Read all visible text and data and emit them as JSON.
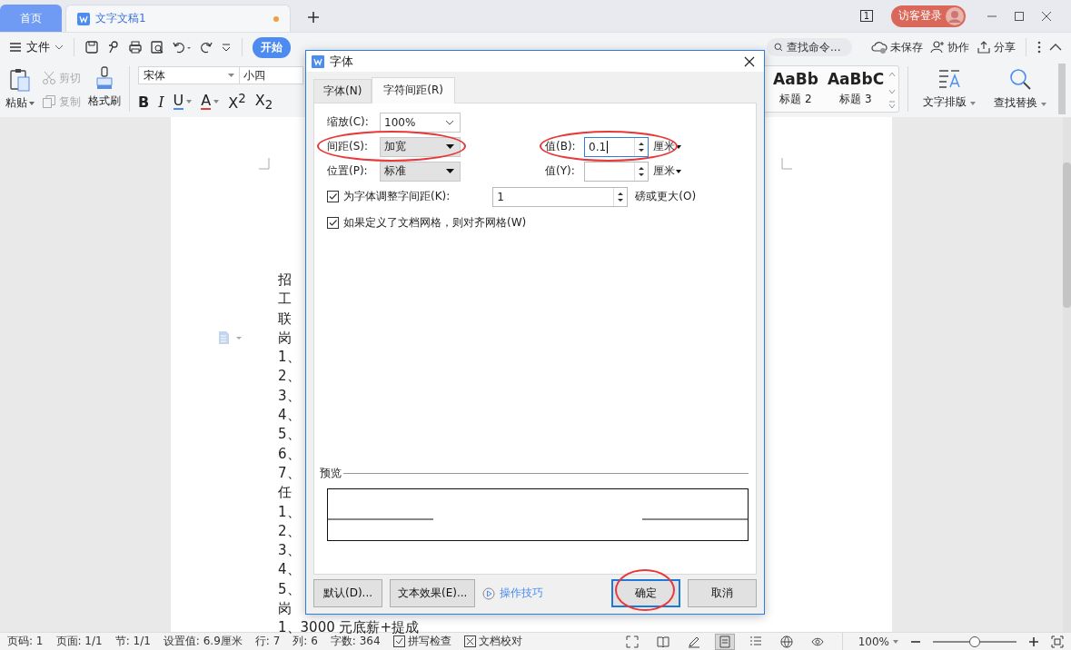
{
  "title_bar": {
    "tabs": [
      {
        "label": "首页",
        "kind": "home",
        "selected": false
      },
      {
        "label": "文字文稿1",
        "kind": "document",
        "selected": true,
        "unsaved": true
      }
    ],
    "page_count": "1",
    "login": "访客登录"
  },
  "menu_bar": {
    "file": "文件",
    "tabs": [
      {
        "label": "开始",
        "selected": true
      }
    ],
    "search": {
      "placeholder": "查找命令..."
    },
    "actions": [
      {
        "label": "未保存",
        "kind": "cloud"
      },
      {
        "label": "协作",
        "kind": "person"
      },
      {
        "label": "分享",
        "kind": "share"
      }
    ]
  },
  "ribbon": {
    "clipboard": [
      {
        "label": "粘贴",
        "kind": "paste",
        "disabled": false
      },
      {
        "label": "剪切",
        "kind": "cut",
        "disabled": true
      },
      {
        "label": "复制",
        "kind": "copy",
        "disabled": true
      },
      {
        "label": "格式刷",
        "kind": "brush",
        "disabled": false
      }
    ],
    "font": {
      "name": "宋体",
      "size": "小四"
    },
    "format_buttons": [
      {
        "label": "B",
        "kind": "bold",
        "dropdown": false
      },
      {
        "label": "I",
        "kind": "italic",
        "dropdown": false
      },
      {
        "label": "U",
        "kind": "underline",
        "dropdown": true
      },
      {
        "label": "A",
        "kind": "strike",
        "dropdown": true
      },
      {
        "label": "X$^{2}$",
        "kind": "plain",
        "dropdown": false
      },
      {
        "label": "X$_{2}$",
        "kind": "plain",
        "dropdown": false
      }
    ],
    "styles": [
      {
        "preview": "AaBb",
        "label": "标题 2"
      },
      {
        "preview": "AaBbC",
        "label": "标题 3"
      }
    ],
    "tools": [
      {
        "label": "文字排版",
        "kind": "layout"
      },
      {
        "label": "查找替换",
        "kind": "search"
      }
    ]
  },
  "document": {
    "lines": [
      "招",
      "工",
      "联",
      "岗",
      "1、",
      "2、",
      "3、",
      "4、",
      "5、",
      "6、",
      "7、",
      "任",
      "1、",
      "2、",
      "3、",
      "4、",
      "5、",
      "岗",
      "1、3000 元底薪+提成"
    ]
  },
  "dialog": {
    "title": "字体",
    "tabs": [
      {
        "label": "字体(N)",
        "selected": false
      },
      {
        "label": "字符间距(R)",
        "selected": true
      }
    ],
    "scale": {
      "label": "缩放(C):",
      "value": "100%"
    },
    "spacing": {
      "label": "间距(S):",
      "value": "加宽",
      "circled": true
    },
    "spacing_value": {
      "label": "值(B):",
      "value": "0.1",
      "unit": "厘米",
      "focused": true,
      "circled": true
    },
    "position": {
      "label": "位置(P):",
      "value": "标准"
    },
    "position_value": {
      "label": "值(Y):",
      "unit": "厘米",
      "focused": false
    },
    "kerning": {
      "label": "为字体调整字间距(K):",
      "checked": true,
      "value": "1",
      "suffix": "磅或更大(O)"
    },
    "snap_to_grid": {
      "label": "如果定义了文档网格，则对齐网格(W)",
      "checked": true
    },
    "preview_label": "预览",
    "buttons": [
      {
        "label": "默认(D)...",
        "kind": "button",
        "default": false,
        "circled": false
      },
      {
        "label": "文本效果(E)...",
        "kind": "button",
        "default": false,
        "circled": false
      },
      {
        "label": "操作技巧",
        "kind": "link"
      },
      {
        "label": "确定",
        "kind": "button",
        "default": true,
        "circled": true
      },
      {
        "label": "取消",
        "kind": "button",
        "default": false,
        "circled": false
      }
    ]
  },
  "status_bar": {
    "items": [
      {
        "text": "页码: 1",
        "kind": "text"
      },
      {
        "text": "页面: 1/1",
        "kind": "text"
      },
      {
        "text": "节: 1/1",
        "kind": "text"
      },
      {
        "text": "设置值: 6.9厘米",
        "kind": "text"
      },
      {
        "text": "行: 7",
        "kind": "text"
      },
      {
        "text": "列: 6",
        "kind": "text"
      },
      {
        "text": "字数: 364",
        "kind": "text"
      },
      {
        "text": "拼写检查",
        "kind": "check"
      },
      {
        "text": "文档校对",
        "kind": "proof"
      }
    ],
    "views": [
      {
        "kind": "fullscreen",
        "selected": false
      },
      {
        "kind": "read",
        "selected": false
      },
      {
        "kind": "edit",
        "selected": false
      },
      {
        "kind": "page",
        "selected": true
      },
      {
        "kind": "outline",
        "selected": false
      },
      {
        "kind": "web",
        "selected": false
      },
      {
        "kind": "eye",
        "selected": false
      }
    ],
    "zoom": {
      "reading": "100%",
      "level": 0.5
    }
  }
}
